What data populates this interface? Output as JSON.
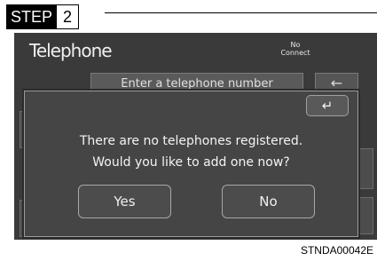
{
  "step": {
    "label": "STEP",
    "number": "2"
  },
  "screen": {
    "title": "Telephone",
    "status_line1": "No",
    "status_line2": "Connect",
    "background_input_text": "Enter a telephone number",
    "background_back_icon": "back-arrow-icon"
  },
  "dialog": {
    "back_icon": "return-arrow-icon",
    "message_line1": "There are no telephones registered.",
    "message_line2": "Would you like to add one now?",
    "yes_label": "Yes",
    "no_label": "No"
  },
  "caption": "STNDA00042E"
}
